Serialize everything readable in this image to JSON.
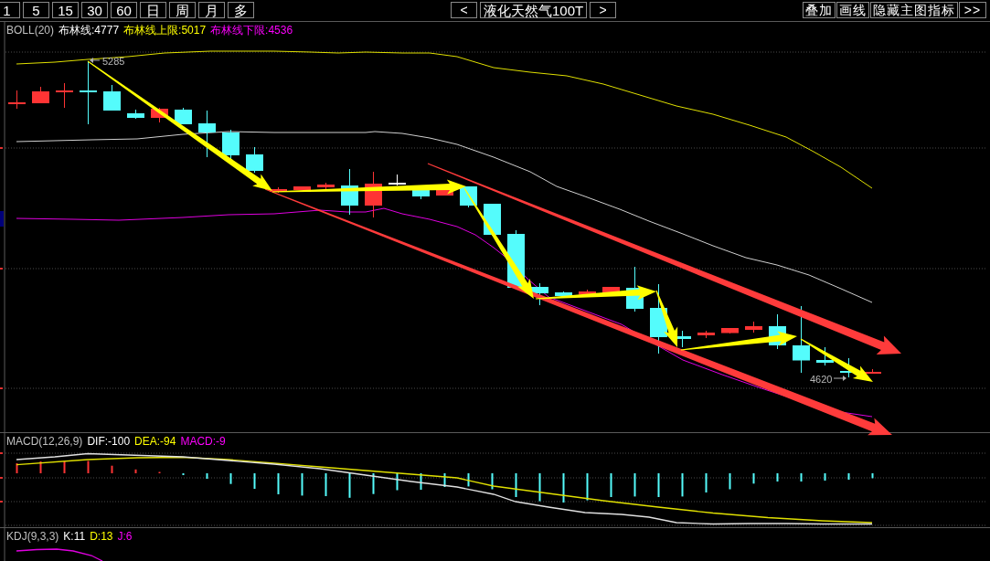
{
  "toolbar": {
    "periods": [
      {
        "label": "1",
        "selected": false
      },
      {
        "label": "5",
        "selected": false
      },
      {
        "label": "15",
        "selected": false
      },
      {
        "label": "30",
        "selected": false
      },
      {
        "label": "60",
        "selected": false
      },
      {
        "label": "日",
        "selected": false
      },
      {
        "label": "周",
        "selected": false
      },
      {
        "label": "月",
        "selected": false
      },
      {
        "label": "多",
        "selected": false
      }
    ],
    "prev_button": "<",
    "instrument": "液化天然气100T",
    "next_button": ">",
    "actions": [
      "叠加",
      "画线",
      "隐藏主图指标",
      ">>"
    ]
  },
  "main_chart": {
    "indicator": {
      "name": "BOLL(20)",
      "values": [
        {
          "label": "布林线:4777",
          "color": "#ffffff"
        },
        {
          "label": "布林线上限:5017",
          "color": "#ffff00"
        },
        {
          "label": "布林线下限:4536",
          "color": "#ff00ff"
        }
      ]
    },
    "high_marker": "5285",
    "low_marker": "4620"
  },
  "macd_panel": {
    "indicator": {
      "name": "MACD(12,26,9)",
      "values": [
        {
          "label": "DIF:-100",
          "color": "#ffffff"
        },
        {
          "label": "DEA:-94",
          "color": "#ffff00"
        },
        {
          "label": "MACD:-9",
          "color": "#ff00ff"
        }
      ]
    }
  },
  "kdj_panel": {
    "indicator": {
      "name": "KDJ(9,3,3)",
      "values": [
        {
          "label": "K:11",
          "color": "#ffffff"
        },
        {
          "label": "D:13",
          "color": "#ffff00"
        },
        {
          "label": "J:6",
          "color": "#ff00ff"
        }
      ]
    }
  }
}
